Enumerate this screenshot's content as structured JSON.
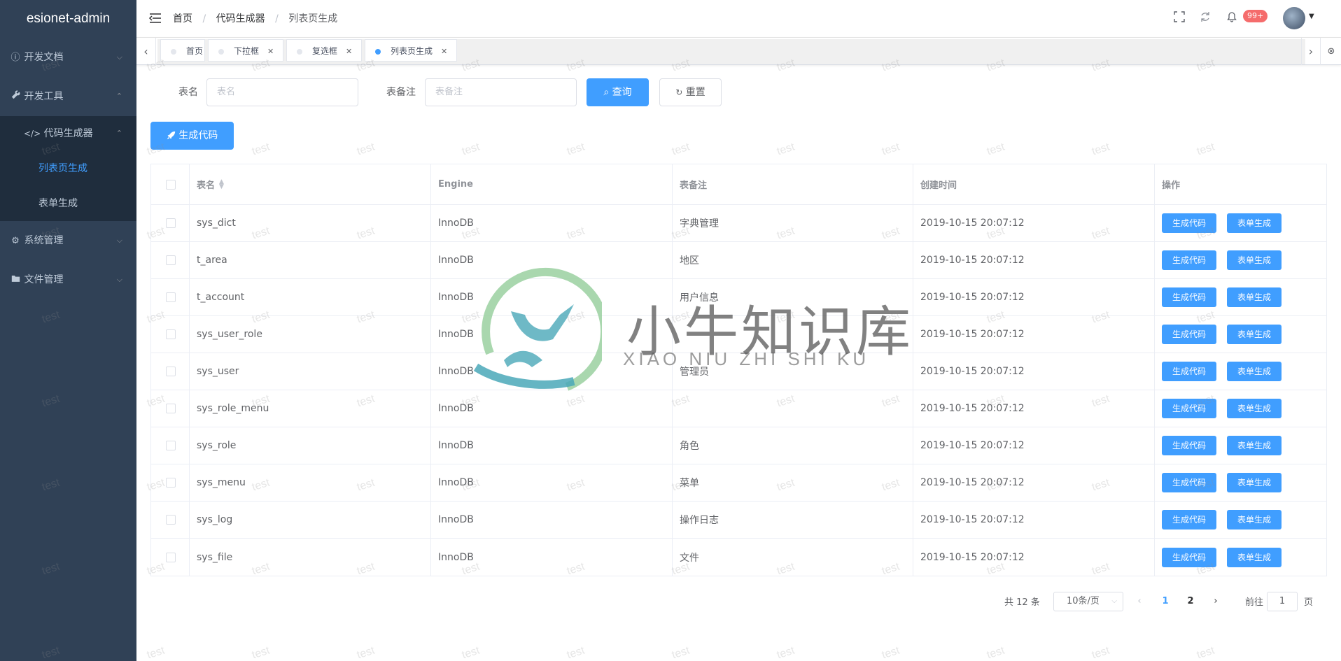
{
  "app": {
    "title": "esionet-admin"
  },
  "sidebar": {
    "items": [
      {
        "label": "开发文档",
        "icon": "info-icon",
        "chevron": "⌵"
      },
      {
        "label": "开发工具",
        "icon": "wrench-icon",
        "chevron": "⌃"
      },
      {
        "label": "代码生成器",
        "icon": "code-icon",
        "chevron": "⌃"
      },
      {
        "label": "列表页生成"
      },
      {
        "label": "表单生成"
      },
      {
        "label": "系统管理",
        "icon": "gear-icon",
        "chevron": "⌵"
      },
      {
        "label": "文件管理",
        "icon": "folder-icon",
        "chevron": "⌵"
      }
    ]
  },
  "header": {
    "breadcrumb": [
      "首页",
      "代码生成器",
      "列表页生成"
    ],
    "separator": "/",
    "badge": "99+"
  },
  "tags": [
    {
      "label": "首页",
      "closable": false,
      "active": false
    },
    {
      "label": "下拉框",
      "closable": true,
      "active": false
    },
    {
      "label": "复选框",
      "closable": true,
      "active": false
    },
    {
      "label": "列表页生成",
      "closable": true,
      "active": true
    }
  ],
  "search": {
    "table_name_label": "表名",
    "table_name_placeholder": "表名",
    "comment_label": "表备注",
    "comment_placeholder": "表备注",
    "query_label": "查询",
    "reset_label": "重置"
  },
  "toolbar": {
    "generate_label": "生成代码"
  },
  "table": {
    "columns": [
      "表名",
      "Engine",
      "表备注",
      "创建时间",
      "操作"
    ],
    "action_generate": "生成代码",
    "action_form": "表单生成",
    "rows": [
      {
        "name": "sys_dict",
        "engine": "InnoDB",
        "comment": "字典管理",
        "created": "2019-10-15 20:07:12"
      },
      {
        "name": "t_area",
        "engine": "InnoDB",
        "comment": "地区",
        "created": "2019-10-15 20:07:12"
      },
      {
        "name": "t_account",
        "engine": "InnoDB",
        "comment": "用户信息",
        "created": "2019-10-15 20:07:12"
      },
      {
        "name": "sys_user_role",
        "engine": "InnoDB",
        "comment": "",
        "created": "2019-10-15 20:07:12"
      },
      {
        "name": "sys_user",
        "engine": "InnoDB",
        "comment": "管理员",
        "created": "2019-10-15 20:07:12"
      },
      {
        "name": "sys_role_menu",
        "engine": "InnoDB",
        "comment": "",
        "created": "2019-10-15 20:07:12"
      },
      {
        "name": "sys_role",
        "engine": "InnoDB",
        "comment": "角色",
        "created": "2019-10-15 20:07:12"
      },
      {
        "name": "sys_menu",
        "engine": "InnoDB",
        "comment": "菜单",
        "created": "2019-10-15 20:07:12"
      },
      {
        "name": "sys_log",
        "engine": "InnoDB",
        "comment": "操作日志",
        "created": "2019-10-15 20:07:12"
      },
      {
        "name": "sys_file",
        "engine": "InnoDB",
        "comment": "文件",
        "created": "2019-10-15 20:07:12"
      }
    ]
  },
  "pagination": {
    "total_text": "共 12 条",
    "page_size": "10条/页",
    "pages": [
      "1",
      "2"
    ],
    "current_page": "1",
    "goto_prefix": "前往",
    "goto_value": "1",
    "goto_suffix": "页"
  },
  "watermark": {
    "title": "小牛知识库",
    "subtitle": "XIAO NIU ZHI SHI KU",
    "text": "test",
    "colors": {
      "ring": "#9ad0a0",
      "mark": "#4aa8b8"
    }
  },
  "colors": {
    "primary": "#409eff",
    "sidebar_bg": "#304156",
    "sidebar_sub_bg": "#1f2d3d",
    "danger": "#f56c6c"
  }
}
